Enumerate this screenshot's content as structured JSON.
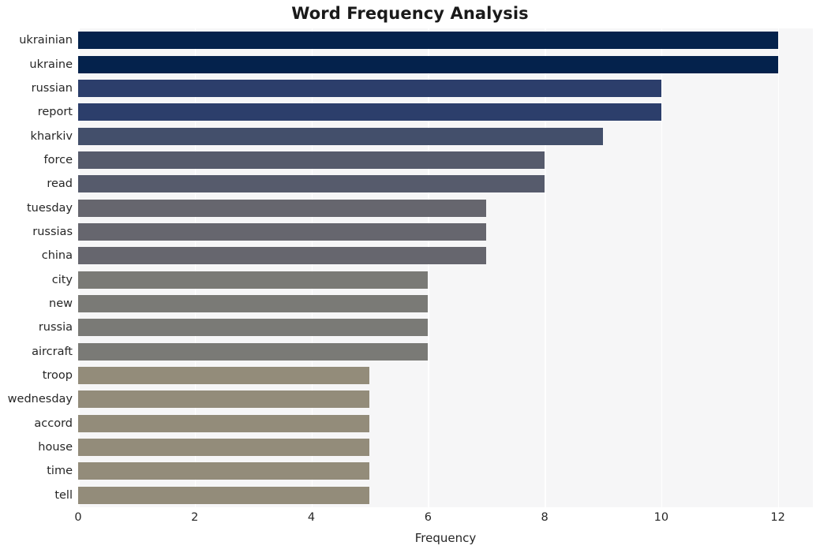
{
  "chart_data": {
    "type": "bar",
    "orientation": "horizontal",
    "title": "Word Frequency Analysis",
    "xlabel": "Frequency",
    "ylabel": "",
    "categories": [
      "ukrainian",
      "ukraine",
      "russian",
      "report",
      "kharkiv",
      "force",
      "read",
      "tuesday",
      "russias",
      "china",
      "city",
      "new",
      "russia",
      "aircraft",
      "troop",
      "wednesday",
      "accord",
      "house",
      "time",
      "tell"
    ],
    "values": [
      12,
      12,
      10,
      10,
      9,
      8,
      8,
      7,
      7,
      7,
      6,
      6,
      6,
      6,
      5,
      5,
      5,
      5,
      5,
      5
    ],
    "bar_colors": [
      "#04224c",
      "#04224c",
      "#2c3e6b",
      "#2c3e6b",
      "#434f6b",
      "#565b6c",
      "#565b6c",
      "#66666e",
      "#66666e",
      "#66666e",
      "#7a7a76",
      "#7a7a76",
      "#7a7a76",
      "#7a7a76",
      "#938c7a",
      "#938c7a",
      "#938c7a",
      "#938c7a",
      "#938c7a",
      "#938c7a"
    ],
    "xlim": [
      0,
      12.6
    ],
    "xticks": [
      0,
      2,
      4,
      6,
      8,
      10,
      12
    ],
    "xtick_labels": [
      "0",
      "2",
      "4",
      "6",
      "8",
      "10",
      "12"
    ],
    "grid": true,
    "grid_axis": "x",
    "grid_color": "#ffffff",
    "plot_background": "#f6f6f7",
    "figure_background": "#ffffff",
    "legend": null
  }
}
